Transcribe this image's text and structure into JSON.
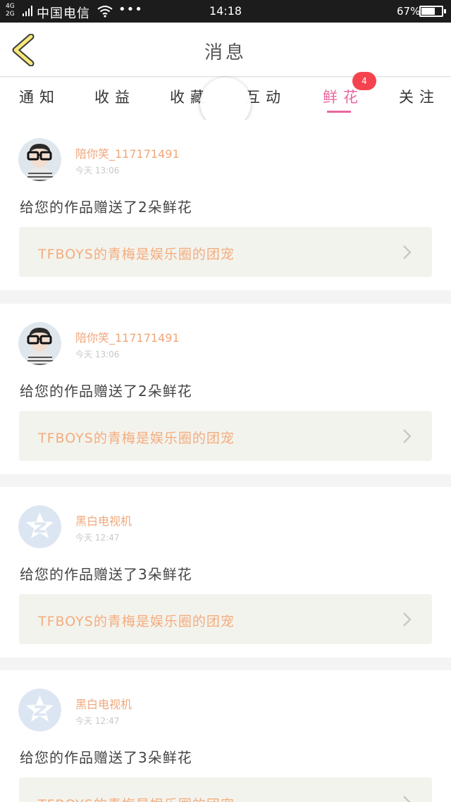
{
  "status_bar": {
    "network_top": "4G",
    "network_bottom": "2G",
    "carrier": "中国电信",
    "overflow": "•••",
    "time": "14:18",
    "battery_percent": "67%",
    "battery_level": 0.67
  },
  "header": {
    "title": "消息"
  },
  "tabs": [
    {
      "label": "通知"
    },
    {
      "label": "收益"
    },
    {
      "label": "收藏"
    },
    {
      "label": "互动"
    },
    {
      "label": "鲜花",
      "badge": "4"
    },
    {
      "label": "关注"
    }
  ],
  "active_tab": "鲜花",
  "messages": [
    {
      "username": "陪你笑_117171491",
      "time": "今天 13:06",
      "text": "给您的作品赠送了2朵鲜花",
      "link": "TFBOYS的青梅是娱乐圈的团宠"
    },
    {
      "username": "陪你笑_117171491",
      "time": "今天 13:06",
      "text": "给您的作品赠送了2朵鲜花",
      "link": "TFBOYS的青梅是娱乐圈的团宠"
    },
    {
      "username": "黑白电视机",
      "time": "今天 12:47",
      "text": "给您的作品赠送了3朵鲜花",
      "link": "TFBOYS的青梅是娱乐圈的团宠"
    },
    {
      "username": "黑白电视机",
      "time": "今天 12:47",
      "text": "给您的作品赠送了3朵鲜花",
      "link": "TFBOYS的青梅是娱乐圈的团宠"
    }
  ],
  "colors": {
    "accent_pink": "#e9679e",
    "badge_red": "#f4434e",
    "username_orange": "#f0a77b",
    "link_orange": "#f3ac7e",
    "back_arrow_yellow": "#f6e87a"
  }
}
